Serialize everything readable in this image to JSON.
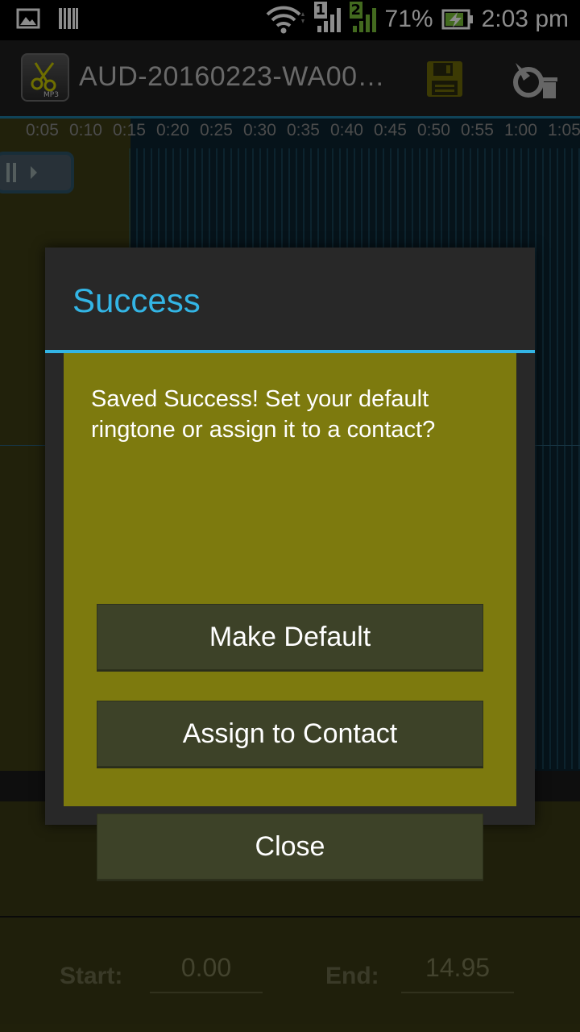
{
  "status_bar": {
    "battery_percent": "71%",
    "time": "2:03 pm",
    "sim1": "1",
    "sim2": "2"
  },
  "action_bar": {
    "title": "AUD-20160223-WA00…",
    "app_icon_label": "MP3"
  },
  "timeline": {
    "ticks": [
      "0:05",
      "0:10",
      "0:15",
      "0:20",
      "0:25",
      "0:30",
      "0:35",
      "0:40",
      "0:45",
      "0:50",
      "0:55",
      "1:00",
      "1:05"
    ]
  },
  "controls": {
    "start_label": "Start:",
    "start_value": "0.00",
    "end_label": "End:",
    "end_value": "14.95"
  },
  "dialog": {
    "title": "Success",
    "message": "Saved Success! Set your default ringtone or assign it to a contact?",
    "buttons": {
      "make_default": "Make Default",
      "assign_contact": "Assign to Contact",
      "close": "Close"
    }
  },
  "colors": {
    "accent": "#33b5e5",
    "dialog_body": "#7d7a0e",
    "button": "#3d4228"
  }
}
